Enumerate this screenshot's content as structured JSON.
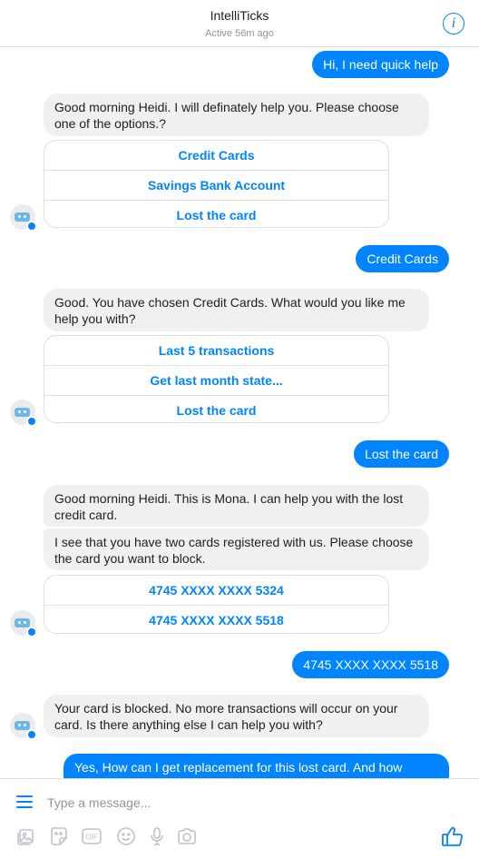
{
  "header": {
    "title": "IntelliTicks",
    "status": "Active 56m ago",
    "info_icon": "info-icon"
  },
  "colors": {
    "accent": "#0084ff",
    "incoming_bubble": "#f1f0f0",
    "border": "#dddfe2",
    "muted": "#90949c"
  },
  "messages": {
    "out1": "Hi, I need quick help",
    "in1": "Good morning Heidi. I will definately help you. Please choose one of the options.?",
    "options1": [
      "Credit Cards",
      "Savings Bank Account",
      "Lost the card"
    ],
    "out2": "Credit Cards",
    "in2": "Good. You have chosen Credit Cards. What would you like me help you with?",
    "options2": [
      "Last 5 transactions",
      "Get last month state...",
      "Lost the card"
    ],
    "out3": "Lost the card",
    "in3a": "Good morning Heidi. This is Mona. I can help you with the lost credit card.",
    "in3b": "I see that you have two cards registered with us. Please choose the card you want to block.",
    "options3": [
      "4745 XXXX XXXX 5324",
      "4745 XXXX XXXX 5518"
    ],
    "out4": "4745 XXXX XXXX 5518",
    "in4": "Your card is blocked. No more transactions will occur on your card. Is there anything else I can help you with?",
    "out5": "Yes, How can I get replacement for this lost card. And how"
  },
  "composer": {
    "placeholder": "Type a message...",
    "tools": [
      "image-icon",
      "sticker-icon",
      "gif-icon",
      "emoji-icon",
      "microphone-icon",
      "camera-icon"
    ],
    "gif_label": "GIF",
    "like_icon": "thumbs-up-icon"
  }
}
